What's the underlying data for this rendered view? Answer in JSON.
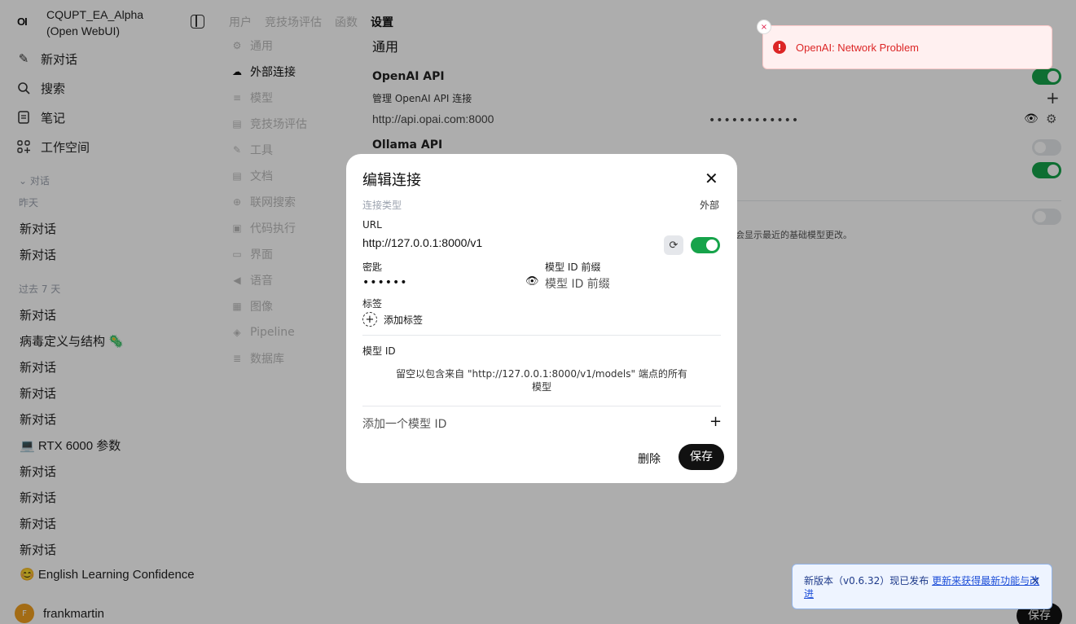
{
  "sidebar": {
    "logo": "OI",
    "app_title": "CQUPT_EA_Alpha (Open WebUI)",
    "nav": [
      {
        "label": "新对话",
        "icon": "edit-icon"
      },
      {
        "label": "搜索",
        "icon": "search-icon"
      },
      {
        "label": "笔记",
        "icon": "notes-icon"
      },
      {
        "label": "工作空间",
        "icon": "workspace-icon"
      }
    ],
    "chats_section": "对话",
    "group_yesterday": "昨天",
    "yesterday_chats": [
      "新对话",
      "新对话"
    ],
    "group_week": "过去 7 天",
    "week_chats": [
      "新对话",
      "病毒定义与结构 🦠",
      "新对话",
      "新对话",
      "新对话",
      "💻 RTX 6000 参数",
      "新对话",
      "新对话",
      "新对话",
      "新对话",
      "😊 English Learning Confidence"
    ],
    "user": {
      "initial": "F",
      "name": "frankmartin"
    }
  },
  "admin": {
    "tabs": [
      "用户",
      "竞技场评估",
      "函数",
      "设置"
    ],
    "active_tab": "设置",
    "settings_nav": [
      {
        "label": "通用",
        "icon": "gear-icon"
      },
      {
        "label": "外部连接",
        "icon": "cloud-icon"
      },
      {
        "label": "模型",
        "icon": "stack-icon"
      },
      {
        "label": "竞技场评估",
        "icon": "doc-icon"
      },
      {
        "label": "工具",
        "icon": "wrench-icon"
      },
      {
        "label": "文档",
        "icon": "doc-icon"
      },
      {
        "label": "联网搜索",
        "icon": "globe-icon"
      },
      {
        "label": "代码执行",
        "icon": "code-icon"
      },
      {
        "label": "界面",
        "icon": "monitor-icon"
      },
      {
        "label": "语音",
        "icon": "speaker-icon"
      },
      {
        "label": "图像",
        "icon": "image-icon"
      },
      {
        "label": "Pipeline",
        "icon": "layers-icon"
      },
      {
        "label": "数据库",
        "icon": "database-icon"
      }
    ],
    "active_nav": "外部连接",
    "main_title": "通用",
    "openai_title": "OpenAI API",
    "manage_label": "管理 OpenAI API 连接",
    "openai_url": "http://api.opai.com:8000",
    "openai_key_masked": "••••••••••••",
    "ollama_title": "Ollama API",
    "partial_text": "会显示最近的基础模型更改。",
    "save": "保存"
  },
  "toast": {
    "message": "OpenAI: Network Problem",
    "close": "×",
    "alert_symbol": "!"
  },
  "update_banner": {
    "text": "新版本（v0.6.32）现已发布",
    "link": "更新来获得最新功能与改进",
    "close": "×"
  },
  "modal": {
    "title": "编辑连接",
    "close": "✕",
    "connection_type_label": "连接类型",
    "connection_type_value": "外部",
    "url_label": "URL",
    "url_value": "http://127.0.0.1:8000/v1",
    "key_label": "密匙",
    "key_value_masked": "••••••",
    "prefix_label": "模型 ID 前缀",
    "prefix_placeholder": "模型 ID 前缀",
    "tags_label": "标签",
    "add_tag": "添加标签",
    "model_id_label": "模型 ID",
    "help_text": "留空以包含来自 \"http://127.0.0.1:8000/v1/models\" 端点的所有模型",
    "add_model_placeholder": "添加一个模型 ID",
    "delete": "删除",
    "save": "保存"
  },
  "colors": {
    "accent_green": "#16a34a",
    "error_red": "#dc2626",
    "info_blue": "#1d4ed8"
  }
}
